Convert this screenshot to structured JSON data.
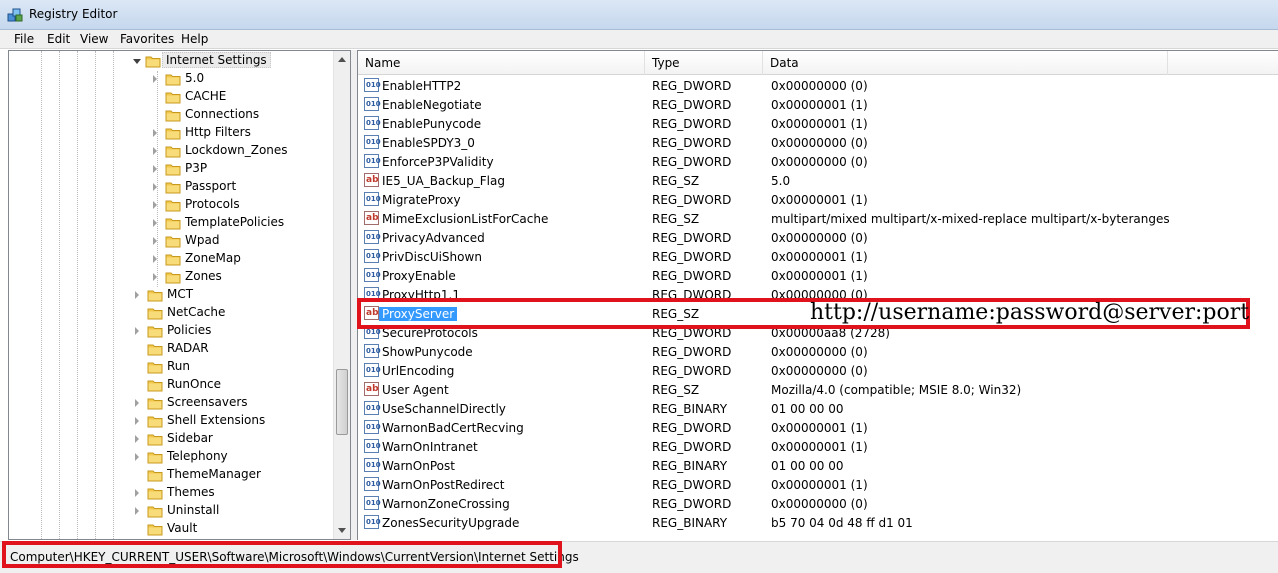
{
  "window": {
    "title": "Registry Editor"
  },
  "menu": [
    "File",
    "Edit",
    "View",
    "Favorites",
    "Help"
  ],
  "tree": {
    "selected": "Internet Settings",
    "children": [
      "5.0",
      "CACHE",
      "Connections",
      "Http Filters",
      "Lockdown_Zones",
      "P3P",
      "Passport",
      "Protocols",
      "TemplatePolicies",
      "Wpad",
      "ZoneMap",
      "Zones"
    ],
    "children_expandable": [
      true,
      false,
      false,
      true,
      true,
      true,
      true,
      true,
      true,
      true,
      true,
      true
    ],
    "siblings": [
      "MCT",
      "NetCache",
      "Policies",
      "RADAR",
      "Run",
      "RunOnce",
      "Screensavers",
      "Shell Extensions",
      "Sidebar",
      "Telephony",
      "ThemeManager",
      "Themes",
      "Uninstall",
      "Vault"
    ],
    "siblings_expandable": [
      true,
      false,
      true,
      false,
      false,
      false,
      true,
      true,
      true,
      true,
      false,
      true,
      true,
      false
    ]
  },
  "list": {
    "columns": [
      "Name",
      "Type",
      "Data"
    ],
    "rows": [
      {
        "name": "EnableHTTP2",
        "type": "REG_DWORD",
        "data": "0x00000000 (0)",
        "icon": "binary-value-icon"
      },
      {
        "name": "EnableNegotiate",
        "type": "REG_DWORD",
        "data": "0x00000001 (1)",
        "icon": "binary-value-icon"
      },
      {
        "name": "EnablePunycode",
        "type": "REG_DWORD",
        "data": "0x00000001 (1)",
        "icon": "binary-value-icon"
      },
      {
        "name": "EnableSPDY3_0",
        "type": "REG_DWORD",
        "data": "0x00000000 (0)",
        "icon": "binary-value-icon"
      },
      {
        "name": "EnforceP3PValidity",
        "type": "REG_DWORD",
        "data": "0x00000000 (0)",
        "icon": "binary-value-icon"
      },
      {
        "name": "IE5_UA_Backup_Flag",
        "type": "REG_SZ",
        "data": "5.0",
        "icon": "string-value-icon"
      },
      {
        "name": "MigrateProxy",
        "type": "REG_DWORD",
        "data": "0x00000001 (1)",
        "icon": "binary-value-icon"
      },
      {
        "name": "MimeExclusionListForCache",
        "type": "REG_SZ",
        "data": "multipart/mixed multipart/x-mixed-replace multipart/x-byteranges",
        "icon": "string-value-icon"
      },
      {
        "name": "PrivacyAdvanced",
        "type": "REG_DWORD",
        "data": "0x00000000 (0)",
        "icon": "binary-value-icon"
      },
      {
        "name": "PrivDiscUiShown",
        "type": "REG_DWORD",
        "data": "0x00000001 (1)",
        "icon": "binary-value-icon"
      },
      {
        "name": "ProxyEnable",
        "type": "REG_DWORD",
        "data": "0x00000001 (1)",
        "icon": "binary-value-icon"
      },
      {
        "name": "ProxyHttp1.1",
        "type": "REG_DWORD",
        "data": "0x00000000 (0)",
        "icon": "binary-value-icon"
      },
      {
        "name": "ProxyServer",
        "type": "REG_SZ",
        "data": "",
        "icon": "string-value-icon",
        "selected": true
      },
      {
        "name": "SecureProtocols",
        "type": "REG_DWORD",
        "data": "0x00000aa8 (2728)",
        "icon": "binary-value-icon"
      },
      {
        "name": "ShowPunycode",
        "type": "REG_DWORD",
        "data": "0x00000000 (0)",
        "icon": "binary-value-icon"
      },
      {
        "name": "UrlEncoding",
        "type": "REG_DWORD",
        "data": "0x00000000 (0)",
        "icon": "binary-value-icon"
      },
      {
        "name": "User Agent",
        "type": "REG_SZ",
        "data": "Mozilla/4.0 (compatible; MSIE 8.0; Win32)",
        "icon": "string-value-icon"
      },
      {
        "name": "UseSchannelDirectly",
        "type": "REG_BINARY",
        "data": "01 00 00 00",
        "icon": "binary-value-icon"
      },
      {
        "name": "WarnonBadCertRecving",
        "type": "REG_DWORD",
        "data": "0x00000001 (1)",
        "icon": "binary-value-icon"
      },
      {
        "name": "WarnOnIntranet",
        "type": "REG_DWORD",
        "data": "0x00000001 (1)",
        "icon": "binary-value-icon"
      },
      {
        "name": "WarnOnPost",
        "type": "REG_BINARY",
        "data": "01 00 00 00",
        "icon": "binary-value-icon"
      },
      {
        "name": "WarnOnPostRedirect",
        "type": "REG_DWORD",
        "data": "0x00000001 (1)",
        "icon": "binary-value-icon"
      },
      {
        "name": "WarnonZoneCrossing",
        "type": "REG_DWORD",
        "data": "0x00000000 (0)",
        "icon": "binary-value-icon"
      },
      {
        "name": "ZonesSecurityUpgrade",
        "type": "REG_BINARY",
        "data": "b5 70 04 0d 48 ff d1 01",
        "icon": "binary-value-icon"
      }
    ]
  },
  "annotation": "http://username:password@server:port",
  "status": "Computer\\HKEY_CURRENT_USER\\Software\\Microsoft\\Windows\\CurrentVersion\\Internet Settings",
  "colors": {
    "highlight": "#e0121c",
    "selection": "#3399ff",
    "folder": "#f2c94c"
  }
}
